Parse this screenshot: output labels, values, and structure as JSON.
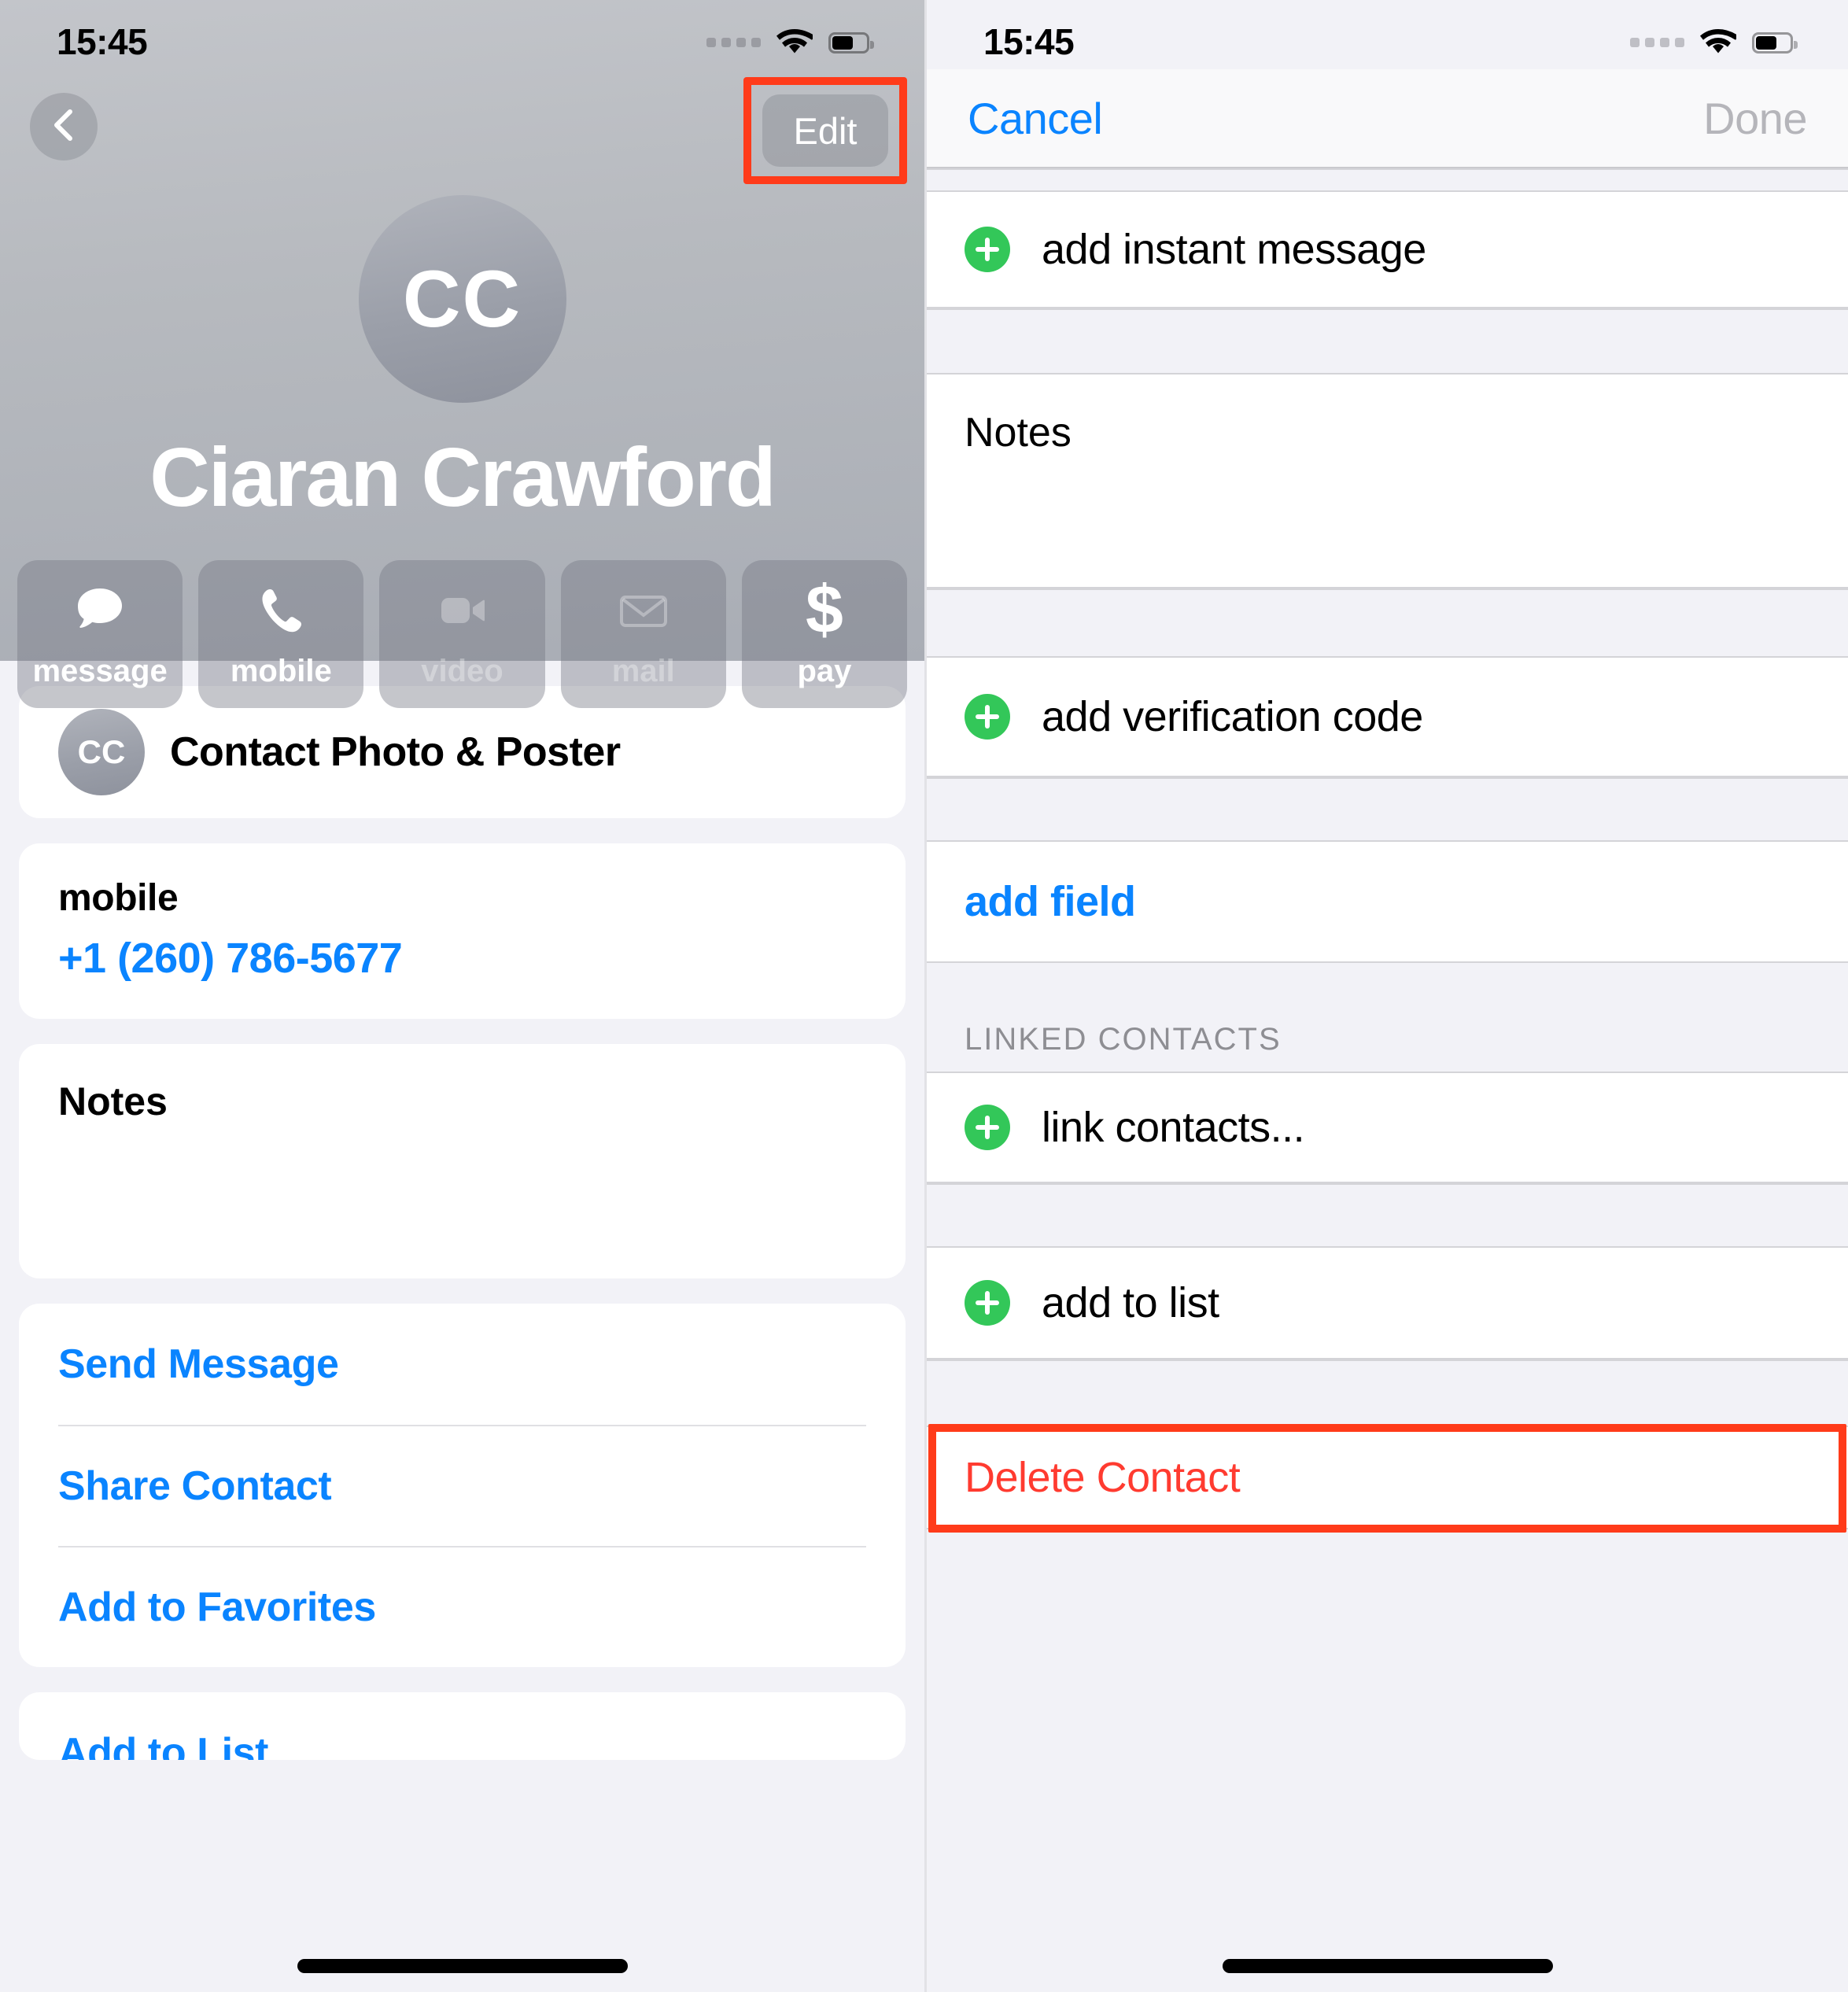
{
  "colors": {
    "accent_blue": "#0a84ff",
    "destructive_red": "#ff3b30",
    "highlight_red": "#ff3b1a",
    "add_green": "#33c759",
    "group_bg": "#f2f2f7"
  },
  "left": {
    "status": {
      "time": "15:45",
      "wifi": "wifi-icon",
      "battery": "battery-icon",
      "signal": "cellular-dots-icon"
    },
    "nav": {
      "back": "back-chevron-icon",
      "edit_label": "Edit"
    },
    "contact": {
      "initials": "CC",
      "name": "Ciaran Crawford"
    },
    "quick_actions": [
      {
        "label": "message",
        "icon": "message-bubble-icon",
        "enabled": true
      },
      {
        "label": "mobile",
        "icon": "phone-icon",
        "enabled": true
      },
      {
        "label": "video",
        "icon": "video-camera-icon",
        "enabled": false
      },
      {
        "label": "mail",
        "icon": "envelope-icon",
        "enabled": false
      },
      {
        "label": "pay",
        "icon": "dollar-sign-icon",
        "enabled": true
      }
    ],
    "photo_poster": {
      "initials": "CC",
      "label": "Contact Photo & Poster"
    },
    "phone": {
      "type": "mobile",
      "number": "+1 (260) 786-5677"
    },
    "notes": {
      "label": "Notes",
      "value": ""
    },
    "actions": [
      "Send Message",
      "Share Contact",
      "Add to Favorites"
    ],
    "actions_2": [
      "Add to List"
    ]
  },
  "right": {
    "status": {
      "time": "15:45",
      "wifi": "wifi-icon",
      "battery": "battery-icon",
      "signal": "cellular-dots-icon"
    },
    "nav": {
      "cancel_label": "Cancel",
      "done_label": "Done"
    },
    "rows": {
      "add_instant_message": "add instant message",
      "notes_label": "Notes",
      "notes_value": "",
      "add_verification_code": "add verification code",
      "add_field": "add field",
      "linked_contacts_header": "LINKED CONTACTS",
      "link_contacts": "link contacts...",
      "add_to_list": "add to list",
      "delete_contact": "Delete Contact"
    }
  }
}
